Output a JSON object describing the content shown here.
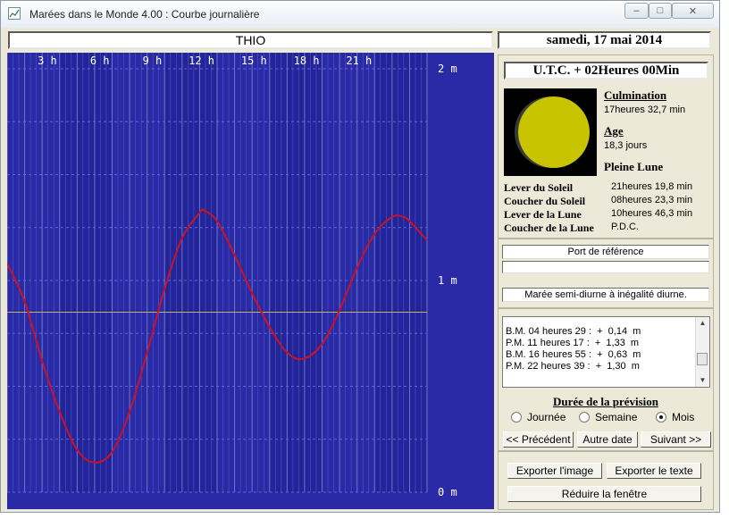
{
  "window": {
    "title": "Marées dans le Monde 4.00 : Courbe journalière"
  },
  "header": {
    "location": "THIO",
    "date": "samedi, 17 mai 2014"
  },
  "chart_data": {
    "type": "line",
    "title": "",
    "x_tick_labels": [
      "3 h",
      "6 h",
      "9 h",
      "12 h",
      "15 h",
      "18 h",
      "21 h"
    ],
    "y_tick_labels": [
      "2 m",
      "1 m",
      "0 m"
    ],
    "ylim": [
      0,
      2
    ],
    "xlim": [
      0,
      24
    ],
    "xlabel": "",
    "ylabel": "",
    "reference_line_y": 0.85,
    "series": [
      {
        "color": "#cc1122",
        "x": [
          0,
          1,
          2,
          3,
          4,
          5,
          6,
          7,
          8,
          9,
          10,
          11,
          11.28,
          12,
          13,
          14,
          15,
          16,
          16.92,
          18,
          19,
          20,
          21,
          22,
          22.65,
          23,
          24
        ],
        "y": [
          1.08,
          0.9,
          0.62,
          0.38,
          0.2,
          0.14,
          0.19,
          0.38,
          0.66,
          0.96,
          1.2,
          1.32,
          1.33,
          1.28,
          1.12,
          0.94,
          0.78,
          0.66,
          0.63,
          0.7,
          0.86,
          1.06,
          1.22,
          1.3,
          1.3,
          1.28,
          1.19
        ]
      }
    ]
  },
  "info": {
    "utc": "U.T.C. + 02Heures 00Min",
    "culmination": {
      "title": "Culmination",
      "value": "17heures 32,7 min"
    },
    "age": {
      "title": "Age",
      "value": "18,3 jours"
    },
    "phase": "Pleine Lune",
    "events": [
      {
        "label": "Lever du Soleil",
        "value": "21heures 19,8 min"
      },
      {
        "label": "Coucher du Soleil",
        "value": "08heures 23,3 min"
      },
      {
        "label": "Lever de la Lune",
        "value": "10heures 46,3 min"
      },
      {
        "label": "Coucher de la Lune",
        "value": "P.D.C."
      }
    ]
  },
  "port": {
    "reference_label": "Port de référence",
    "tide_type": "Marée semi-diurne à inégalité diurne."
  },
  "tides": [
    "B.M. 04 heures 29 :  +  0,14  m",
    "P.M. 11 heures 17 :  +  1,33  m",
    "B.M. 16 heures 55 :  +  0,63  m",
    "P.M. 22 heures 39 :  +  1,30  m"
  ],
  "forecast": {
    "title": "Durée de la prévision",
    "options": [
      "Journée",
      "Semaine",
      "Mois"
    ],
    "selected": "Mois"
  },
  "nav": {
    "prev": "<< Précédent",
    "other": "Autre date",
    "next": "Suivant >>"
  },
  "actions": {
    "export_image": "Exporter l'image",
    "export_text": "Exporter le texte",
    "reduce": "Réduire la fenêtre"
  },
  "colors": {
    "chart_bg": "#2a2aa6",
    "curve": "#cc1122",
    "moon": "#c8c400",
    "accent_line": "#c8b060"
  }
}
